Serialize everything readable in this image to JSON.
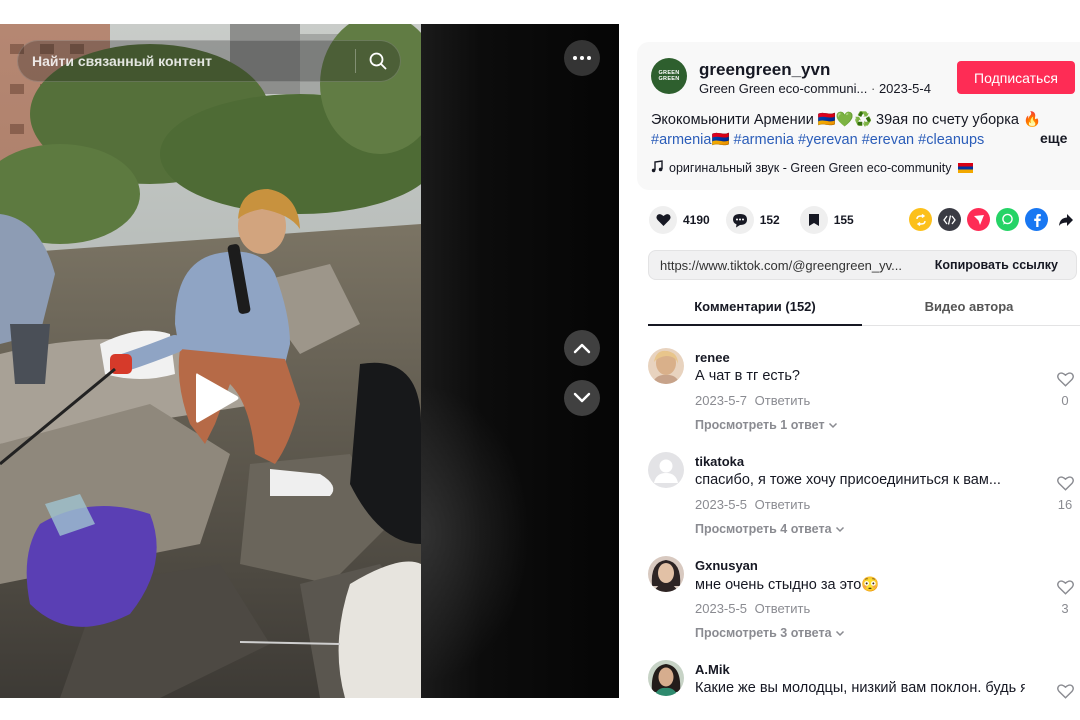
{
  "video": {
    "search_placeholder": "Найти связанный контент",
    "icons": {
      "search": "search-icon",
      "more": "more-dots-icon",
      "up": "chevron-up-icon",
      "down": "chevron-down-icon",
      "play": "play-icon"
    }
  },
  "author": {
    "avatar_line1": "GREEN",
    "avatar_line2": "GREEN",
    "username": "greengreen_yvn",
    "nickname": "Green  Green  eco-communi...",
    "date": "2023-5-4",
    "follow_label": "Подписаться"
  },
  "post": {
    "description": "Экокомьюнити Армении 🇦🇲💚♻️ 39ая по счету уборка 🔥",
    "hashtags": [
      "#armenia🇦🇲",
      "#armenia",
      "#yerevan",
      "#erevan",
      "#cleanups"
    ],
    "more_label": "еще",
    "music": "оригинальный звук - Green  Green  eco-community",
    "likes": "4190",
    "comments": "152",
    "saves": "155",
    "share_icons": [
      "repost-icon",
      "embed-icon",
      "send-icon",
      "whatsapp-icon",
      "facebook-icon",
      "share-arrow-icon"
    ],
    "link": "https://www.tiktok.com/@greengreen_yv...",
    "copy_label": "Копировать ссылку"
  },
  "colors": {
    "accent": "#fe2c55",
    "hashtag": "#2b5db9",
    "brand_avatar": "#2e5f2e"
  },
  "tabs": [
    {
      "label": "Комментарии (152)",
      "active": true
    },
    {
      "label": "Видео автора",
      "active": false
    }
  ],
  "comments": [
    {
      "user": "renee",
      "text": "А чат в тг есть?",
      "date": "2023-5-7",
      "reply": "Ответить",
      "replies": "Просмотреть 1 ответ",
      "likes": "0"
    },
    {
      "user": "tikatoka",
      "text": "спасибо, я тоже хочу присоединиться к вам...",
      "date": "2023-5-5",
      "reply": "Ответить",
      "replies": "Просмотреть 4 ответа",
      "likes": "16"
    },
    {
      "user": "Gxnusyan",
      "text": "мне очень стыдно за это😳",
      "date": "2023-5-5",
      "reply": "Ответить",
      "replies": "Просмотреть 3 ответа",
      "likes": "3"
    },
    {
      "user": "A.Mik",
      "text": "Какие же вы молодцы, низкий вам поклон. будь я"
    }
  ]
}
